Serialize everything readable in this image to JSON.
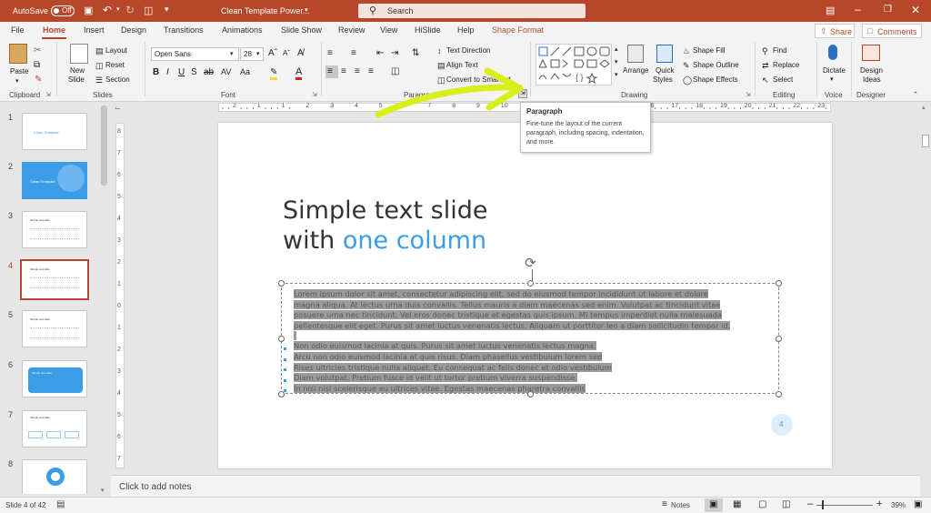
{
  "titlebar": {
    "autosave": "AutoSave",
    "toggle": "Off",
    "doc_title": "Clean Template Power...",
    "search_placeholder": "Search"
  },
  "tabs": [
    "File",
    "Home",
    "Insert",
    "Design",
    "Transitions",
    "Animations",
    "Slide Show",
    "Review",
    "View",
    "HiSlide",
    "Help",
    "Shape Format"
  ],
  "share": "Share",
  "comments": "Comments",
  "ribbon": {
    "clipboard": {
      "paste": "Paste",
      "label": "Clipboard"
    },
    "slides": {
      "new_slide": "New",
      "new_slide2": "Slide",
      "layout": "Layout",
      "reset": "Reset",
      "section": "Section",
      "label": "Slides"
    },
    "font": {
      "family": "Open Sans",
      "size": "28",
      "label": "Font"
    },
    "paragraph": {
      "text_direction": "Text Direction",
      "align_text": "Align Text",
      "convert": "Convert to SmartArt",
      "label": "Paragraph"
    },
    "drawing": {
      "arrange": "Arrange",
      "quick": "Quick",
      "styles": "Styles",
      "fill": "Shape Fill",
      "outline": "Shape Outline",
      "effects": "Shape Effects",
      "label": "Drawing"
    },
    "editing": {
      "find": "Find",
      "replace": "Replace",
      "select": "Select",
      "label": "Editing"
    },
    "voice": {
      "dictate": "Dictate",
      "label": "Voice"
    },
    "designer": {
      "ideas": "Design",
      "ideas2": "Ideas",
      "label": "Designer"
    }
  },
  "tooltip": {
    "title": "Paragraph",
    "body": "Fine-tune the layout of the current paragraph, including spacing, indentation, and more."
  },
  "ruler": [
    "2",
    "1",
    "1",
    "2",
    "3",
    "4",
    "5",
    "6",
    "7",
    "8",
    "9",
    "10",
    "11",
    "12",
    "13",
    "14",
    "15",
    "16",
    "17",
    "18",
    "19",
    "20",
    "21",
    "22",
    "23"
  ],
  "vruler": [
    "8",
    "7",
    "6",
    "5",
    "4",
    "3",
    "2",
    "1",
    "0",
    "1",
    "2",
    "3",
    "4",
    "5",
    "6",
    "7"
  ],
  "thumbs": [
    {
      "num": "1",
      "title": "Clean Template"
    },
    {
      "num": "2",
      "title": "Clean Template"
    },
    {
      "num": "3",
      "title": "Simple text slide"
    },
    {
      "num": "4",
      "title": "Simple text slide"
    },
    {
      "num": "5",
      "title": "Simple text slide"
    },
    {
      "num": "6",
      "title": "Simple text slide"
    },
    {
      "num": "7",
      "title": "Simple text slide"
    },
    {
      "num": "8",
      "title": ""
    }
  ],
  "slide": {
    "title_line1": "Simple text slide",
    "title_line2a": "with ",
    "title_line2b": "one column",
    "para": [
      "Lorem ipsum dolor sit amet, consectetur adipiscing elit, sed do eiusmod tempor incididunt ut labore et dolore",
      "magna aliqua. At lectus urna duis convallis. Tellus mauris a diam maecenas sed enim. Volutpat ac tincidunt vitae",
      "posuere urna nec tincidunt. Vel eros donec tristique et egestas quis ipsum. Mi tempus imperdiet nulla malesuada",
      "pellentesque elit eget. Purus sit amet luctus venenatis lectus. Aliquam ut porttitor leo a diam sollicitudin tempor id."
    ],
    "bullets": [
      "Non odio euismod lacinia at quis. Purus sit amet luctus venenatis lectus magna.",
      "Arcu non odio euismod lacinia at quis risus. Diam phasellus vestibulum lorem sed",
      "Rises ultricies tristique nulla aliquet. Eu consequat ac felis donec et odio vestibulum",
      "Diam volutpat. Pretium fusce id velit ut tortor pretium viverra suspendisse.",
      "In nisi nisi scelerisque eu ultrices vitae. Egestas maecenas pharetra convallis"
    ],
    "page_number": "4"
  },
  "notes_placeholder": "Click to add notes",
  "status": {
    "slide": "Slide 4 of 42",
    "notes": "Notes",
    "zoom": "39%"
  },
  "colors": {
    "accent": "#b7472a",
    "blue": "#3b9de8",
    "arrow": "#d8ef1a"
  }
}
